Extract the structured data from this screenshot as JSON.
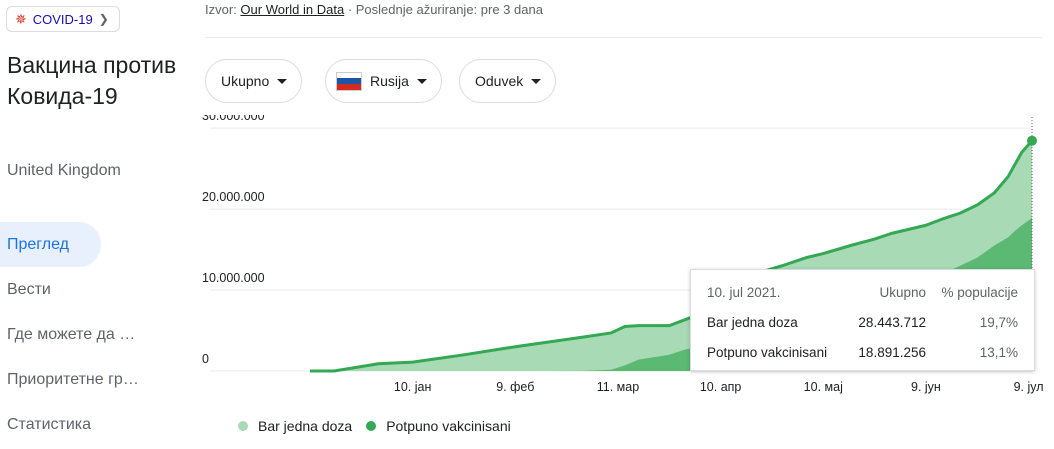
{
  "topic_chip": {
    "label": "COVID-19",
    "icon": "virus-icon",
    "chevron": "chevron-right-icon"
  },
  "title": "Вакцина против Ковида-19",
  "subtitle": "United Kingdom",
  "nav": [
    {
      "label": "Преглед",
      "active": true
    },
    {
      "label": "Вести",
      "active": false
    },
    {
      "label": "Где можете да …",
      "active": false
    },
    {
      "label": "Приоритетне гр…",
      "active": false
    },
    {
      "label": "Статистика",
      "active": false
    }
  ],
  "source": {
    "prefix": "Izvor: ",
    "link": "Our World in Data",
    "suffix": " · Poslednje ažuriranje: pre 3 dana"
  },
  "filters": {
    "metric": "Ukupno",
    "country": "Rusija",
    "period": "Oduvek"
  },
  "colors": {
    "first_dose": "#a8dab5",
    "fully": "#5bb974",
    "line": "#34a853",
    "accent": "#1a73e8"
  },
  "tooltip": {
    "date": "10. jul 2021.",
    "col_total": "Ukupno",
    "col_pct": "% populacije",
    "rows": [
      {
        "label": "Bar jedna doza",
        "total": "28.443.712",
        "pct": "19,7%"
      },
      {
        "label": "Potpuno vakcinisani",
        "total": "18.891.256",
        "pct": "13,1%"
      }
    ]
  },
  "legend": {
    "first_dose": "Bar jedna doza",
    "fully": "Potpuno vakcinisani"
  },
  "chart_data": {
    "type": "area",
    "y_ticks": [
      "30.000.000",
      "20.000.000",
      "10.000.000",
      "0"
    ],
    "y_tick_values": [
      30000000,
      20000000,
      10000000,
      0
    ],
    "ylim": [
      0,
      31000000
    ],
    "x_ticks": [
      "10. јан",
      "9. феб",
      "11. мар",
      "10. апр",
      "10. мај",
      "9. јун",
      "9. јул"
    ],
    "x_tick_days": [
      10,
      40,
      70,
      100,
      130,
      160,
      190
    ],
    "x_days_domain": [
      -20,
      191
    ],
    "series": [
      {
        "name": "Bar jedna doza",
        "x_days": [
          -20,
          -13,
          0,
          10,
          25,
          40,
          50,
          60,
          68,
          72,
          76,
          85,
          90,
          100,
          105,
          110,
          118,
          125,
          130,
          138,
          145,
          150,
          160,
          165,
          170,
          175,
          180,
          184,
          186,
          188,
          191
        ],
        "values": [
          0,
          0,
          900000,
          1100000,
          2000000,
          3000000,
          3600000,
          4200000,
          4700000,
          5500000,
          5600000,
          5600000,
          6400000,
          8000000,
          9700000,
          12000000,
          13000000,
          14000000,
          14500000,
          15500000,
          16300000,
          17000000,
          18000000,
          18800000,
          19500000,
          20500000,
          22000000,
          24000000,
          25500000,
          27000000,
          28443712
        ]
      },
      {
        "name": "Potpuno vakcinisani",
        "x_days": [
          -20,
          -13,
          0,
          10,
          25,
          40,
          50,
          60,
          68,
          72,
          76,
          85,
          90,
          100,
          105,
          110,
          118,
          125,
          130,
          138,
          145,
          150,
          160,
          165,
          170,
          175,
          180,
          184,
          186,
          188,
          191
        ],
        "values": [
          0,
          0,
          0,
          0,
          0,
          0,
          0,
          30000,
          150000,
          700000,
          1400000,
          2000000,
          2700000,
          3500000,
          4200000,
          5000000,
          5700000,
          6500000,
          7200000,
          8200000,
          9000000,
          9700000,
          11000000,
          12000000,
          13000000,
          14000000,
          15500000,
          16500000,
          17300000,
          18000000,
          18891256
        ]
      }
    ]
  }
}
